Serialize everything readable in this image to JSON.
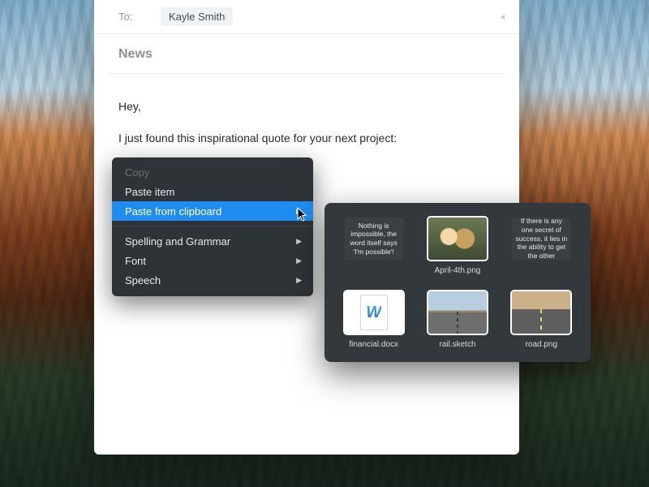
{
  "compose": {
    "to_label": "To:",
    "recipient": "Kayle Smith",
    "subject": "News",
    "body_line1": "Hey,",
    "body_line2": "I just found this inspirational quote for your next project:"
  },
  "context_menu": {
    "items": [
      {
        "label": "Copy",
        "disabled": true,
        "has_submenu": false,
        "highlight": false
      },
      {
        "label": "Paste item",
        "disabled": false,
        "has_submenu": false,
        "highlight": false
      },
      {
        "label": "Paste from clipboard",
        "disabled": false,
        "has_submenu": true,
        "highlight": true
      },
      {
        "label": "Spelling and Grammar",
        "disabled": false,
        "has_submenu": true,
        "highlight": false
      },
      {
        "label": "Font",
        "disabled": false,
        "has_submenu": true,
        "highlight": false
      },
      {
        "label": "Speech",
        "disabled": false,
        "has_submenu": true,
        "highlight": false
      }
    ]
  },
  "clipboard": {
    "items": [
      {
        "kind": "text",
        "text": "Nothing is impossible, the word itself says 'I'm possible'!",
        "caption": ""
      },
      {
        "kind": "image",
        "caption": "April-4th.png"
      },
      {
        "kind": "text",
        "text": "If there is any one secret of success, it lies in the ability to get the other",
        "caption": ""
      },
      {
        "kind": "file",
        "caption": "financial.docx"
      },
      {
        "kind": "image",
        "caption": "rail.sketch"
      },
      {
        "kind": "image",
        "caption": "road.png"
      }
    ]
  },
  "colors": {
    "highlight": "#1f8cf0",
    "panel": "#2e3338",
    "popover": "#33383d"
  }
}
